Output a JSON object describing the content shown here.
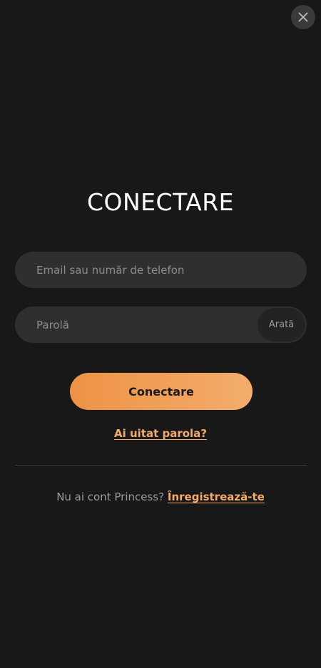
{
  "modal": {
    "close_icon": "close-icon",
    "title": "CONECTARE"
  },
  "form": {
    "email_placeholder": "Email sau număr de telefon",
    "password_placeholder": "Parolă",
    "show_password_label": "Arată",
    "submit_label": "Conectare",
    "forgot_password_label": "Ai uitat parola?"
  },
  "footer": {
    "signup_prompt": "Nu ai cont Princess?",
    "signup_link": "Înregistrează-te"
  },
  "colors": {
    "background": "#181818",
    "field_background": "#2f2f2f",
    "accent_start": "#ee9244",
    "accent_end": "#f3ad6d",
    "link": "#f3aa6a"
  }
}
